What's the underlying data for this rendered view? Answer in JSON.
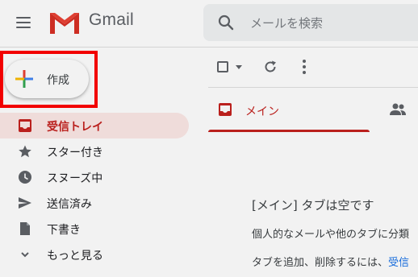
{
  "header": {
    "brand": "Gmail",
    "search_placeholder": "メールを検索"
  },
  "compose": {
    "label": "作成"
  },
  "sidebar": {
    "items": [
      {
        "label": "受信トレイ",
        "icon": "inbox-icon",
        "active": true
      },
      {
        "label": "スター付き",
        "icon": "star-icon",
        "active": false
      },
      {
        "label": "スヌーズ中",
        "icon": "clock-icon",
        "active": false
      },
      {
        "label": "送信済み",
        "icon": "send-icon",
        "active": false
      },
      {
        "label": "下書き",
        "icon": "draft-icon",
        "active": false
      },
      {
        "label": "もっと見る",
        "icon": "chevron-down-icon",
        "active": false
      }
    ]
  },
  "tabs": {
    "main_label": "メイン"
  },
  "empty_state": {
    "title": "[メイン] タブは空です",
    "line1": "個人的なメールや他のタブに分類",
    "line2_prefix": "タブを追加、削除するには、",
    "line2_link": "受信"
  },
  "colors": {
    "accent_red": "#c5221f",
    "active_bg": "#fce8e6",
    "highlight": "#ff0000",
    "link": "#1a73e8"
  }
}
